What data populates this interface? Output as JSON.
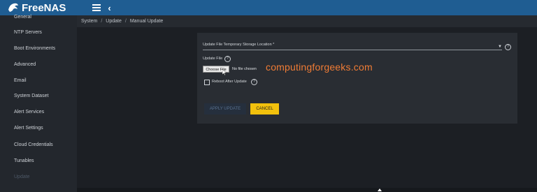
{
  "app": {
    "logo_text": "FreeNAS"
  },
  "topbar": {
    "menu_icon": "hamburger-icon",
    "back_icon": "chevron-left-icon"
  },
  "sidebar": {
    "items": [
      {
        "label": "General"
      },
      {
        "label": "NTP Servers"
      },
      {
        "label": "Boot Environments"
      },
      {
        "label": "Advanced"
      },
      {
        "label": "Email"
      },
      {
        "label": "System Dataset"
      },
      {
        "label": "Alert Services"
      },
      {
        "label": "Alert Settings"
      },
      {
        "label": "Cloud Credentials"
      },
      {
        "label": "Tunables"
      },
      {
        "label": "Update"
      }
    ]
  },
  "breadcrumb": {
    "items": [
      "System",
      "Update",
      "Manual Update"
    ],
    "separator": "/"
  },
  "form": {
    "storage_location_label": "Update File Temporary Storage Location *",
    "update_file_label": "Update File",
    "choose_file_label": "Choose File",
    "no_file_text": "No file chosen",
    "reboot_label": "Reboot After Update",
    "reboot_checked": false,
    "apply_label": "APPLY UPDATE",
    "cancel_label": "CANCEL"
  },
  "watermark": "computingforgeeks.com",
  "colors": {
    "topbar": "#1f5d92",
    "cancel_accent": "#f2c10d",
    "watermark": "#f07c35"
  }
}
